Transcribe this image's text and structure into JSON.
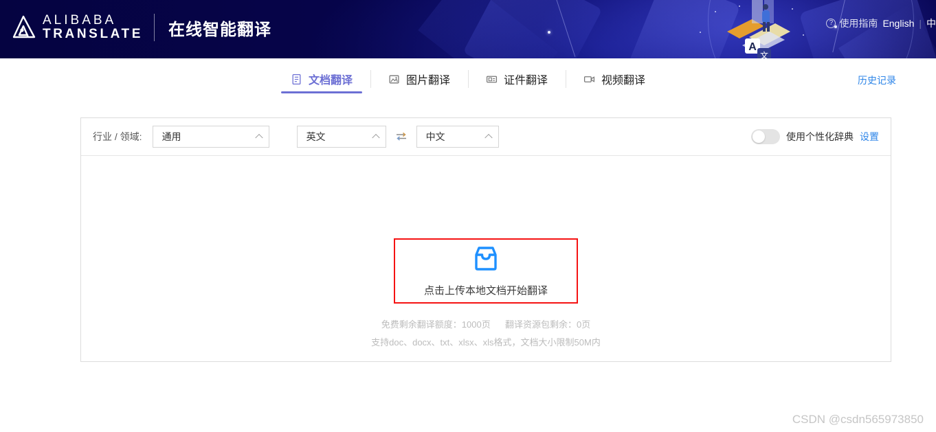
{
  "header": {
    "logo_line1": "ALIBABA",
    "logo_line2": "TRANSLATE",
    "logo_cn": "在线智能翻译",
    "guide_label": "使用指南",
    "guide_icon": "question-circle-icon",
    "lang_en": "English",
    "lang_separator": "|",
    "lang_cn": "中",
    "bg_color": "#060449"
  },
  "tabs": [
    {
      "label": "文档翻译",
      "icon": "document-icon",
      "active": true
    },
    {
      "label": "图片翻译",
      "icon": "image-icon",
      "active": false
    },
    {
      "label": "证件翻译",
      "icon": "id-card-icon",
      "active": false
    },
    {
      "label": "视频翻译",
      "icon": "video-camera-icon",
      "active": false
    }
  ],
  "history_link": "历史记录",
  "toolbar": {
    "domain_label": "行业 / 领域:",
    "domain_value": "通用",
    "source_lang": "英文",
    "target_lang": "中文",
    "swap_icon": "swap-horizontal-icon",
    "dictionary_label": "使用个性化辞典",
    "dictionary_enabled": false,
    "settings_link": "设置"
  },
  "upload": {
    "icon": "inbox-tray-icon",
    "cta_text": "点击上传本地文档开始翻译",
    "highlight_color": "#f51212",
    "icon_color": "#1e90ff",
    "quota_free": "免费剩余翻译额度：1000页",
    "quota_package": "翻译资源包剩余：0页",
    "formats": "支持doc、docx、txt、xlsx、xls格式，文档大小限制50M内"
  },
  "watermark": "CSDN @csdn565973850",
  "accent_colors": {
    "tab_active": "#6c6fd4",
    "link_blue": "#2f86e8"
  }
}
